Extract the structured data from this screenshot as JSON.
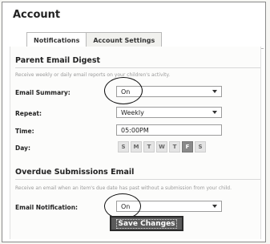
{
  "page": {
    "title": "Account"
  },
  "tabs": [
    {
      "label": "Notifications",
      "active": true
    },
    {
      "label": "Account Settings",
      "active": false
    }
  ],
  "digest": {
    "heading": "Parent Email Digest",
    "hint": "Receive weekly or daily email reports on your children's activity.",
    "summary_label": "Email Summary:",
    "summary_value": "On",
    "repeat_label": "Repeat:",
    "repeat_value": "Weekly",
    "time_label": "Time:",
    "time_value": "05:00PM",
    "day_label": "Day:",
    "days": [
      "S",
      "M",
      "T",
      "W",
      "T",
      "F",
      "S"
    ],
    "selected_day_index": 5
  },
  "overdue": {
    "heading": "Overdue Submissions Email",
    "hint": "Receive an email when an item's due date has past without a submission from your child.",
    "notification_label": "Email Notification:",
    "notification_value": "On"
  },
  "actions": {
    "save_label": "Save Changes"
  },
  "colors": {
    "selected_day": "#8a8a8a",
    "button": "#5a5a5a"
  }
}
